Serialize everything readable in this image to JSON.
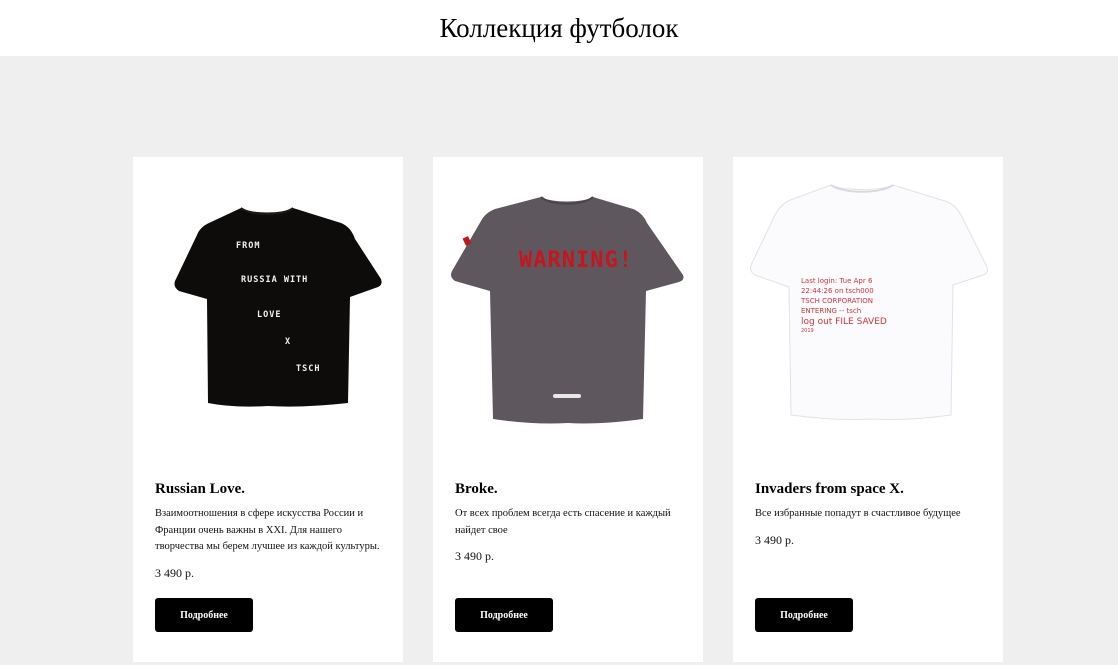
{
  "header": {
    "title": "Коллекция футболок"
  },
  "products": [
    {
      "name": "Russian Love.",
      "description": "Взаимоотношения в сфере искусства России и Франции очень важны в XXI. Для нашего творчества мы берем лучшее из каждой культуры.",
      "price": "3 490 р.",
      "button_label": "Подробнее",
      "image": {
        "shirt_color": "#0e0b0b",
        "print_color": "#f2f2f2",
        "print_lines": [
          "FROM",
          "RUSSIA WITH",
          "LOVE",
          "X",
          "TSCH"
        ]
      }
    },
    {
      "name": "Broke.",
      "description": "От всех проблем всегда есть спасение и каждый найдет свое",
      "price": "3 490 р.",
      "button_label": "Подробнее",
      "image": {
        "shirt_color": "#5e585e",
        "print_color": "#c8141e",
        "print_text": "WARNING!"
      }
    },
    {
      "name": "Invaders from space X.",
      "description": "Все избранные попадут в счастливое будущее",
      "price": "3 490 р.",
      "button_label": "Подробнее",
      "image": {
        "shirt_color": "#fbfbfd",
        "print_color": "#d5323c",
        "print_lines": [
          "Last login: Tue Apr 6",
          "22:44:26 on tsch000",
          "TSCH CORPORATION",
          "ENTERING -- tsch",
          "log out FILE SAVED",
          "2019"
        ]
      }
    }
  ]
}
